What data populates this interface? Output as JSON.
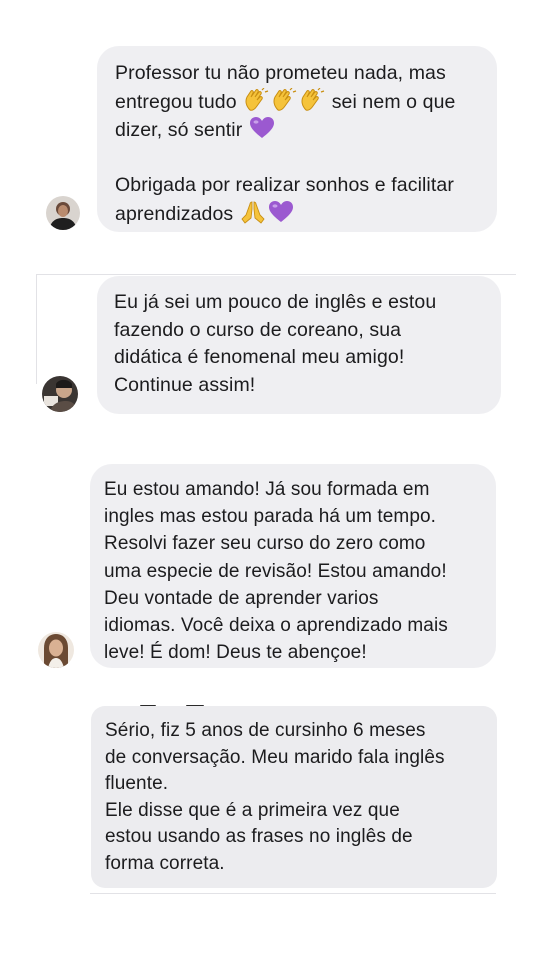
{
  "messages": [
    {
      "id": "m1",
      "line1": "Professor tu não prometeu nada, mas",
      "line2_before": "entregou tudo ",
      "line2_after": " sei nem o que",
      "line3": "dizer, só sentir ",
      "line4": "",
      "line5": "Obrigada por realizar sonhos e facilitar",
      "line6": "aprendizados ",
      "emojis": [
        "clapping-hands",
        "clapping-hands",
        "clapping-hands",
        "purple-heart",
        "folded-hands",
        "purple-heart"
      ]
    },
    {
      "id": "m2",
      "text": "Eu já sei um pouco de inglês e estou\nfazendo o curso de coreano, sua\ndidática é fenomenal meu amigo!\nContinue assim!"
    },
    {
      "id": "m3",
      "text": "Eu estou amando! Já sou formada em\ningles mas estou parada há um tempo.\nResolvi fazer seu curso do zero como\numa especie de revisão! Estou amando!\nDeu vontade de aprender varios\nidiomas. Você deixa o aprendizado mais\nleve! É dom! Deus te abençoe!"
    },
    {
      "id": "m4",
      "text": "Sério, fiz 5 anos de cursinho 6 meses\nde conversação. Meu marido fala inglês\nfluente.\nEle disse que é a primeira vez que\nestou usando as frases no inglês de\nforma correta."
    }
  ],
  "colors": {
    "bubble": "#efeff2",
    "text": "#1c1c1e",
    "heart": "#9b59d0",
    "clap": "#f5c33b"
  }
}
